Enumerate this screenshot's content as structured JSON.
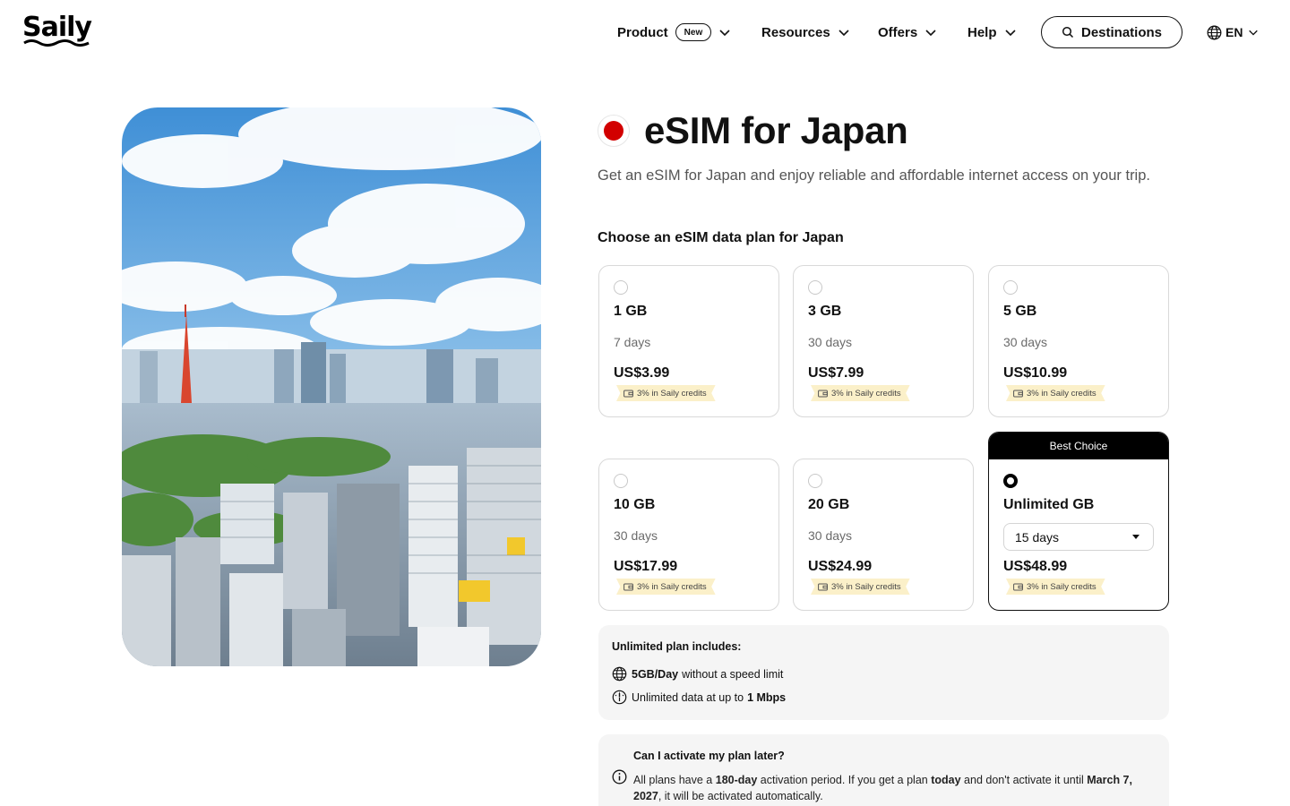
{
  "header": {
    "logo": "Saily",
    "nav": [
      {
        "label": "Product",
        "badge": "New"
      },
      {
        "label": "Resources"
      },
      {
        "label": "Offers"
      },
      {
        "label": "Help"
      }
    ],
    "destinations_label": "Destinations",
    "language": "EN"
  },
  "hero": {
    "title": "eSIM for Japan",
    "subtitle": "Get an eSIM for Japan and enjoy reliable and affordable internet access on your trip.",
    "flag_color": "#d20000"
  },
  "plans_heading": "Choose an eSIM data plan for Japan",
  "plans": [
    {
      "data": "1 GB",
      "duration": "7 days",
      "price": "US$3.99",
      "credit": "3% in Saily credits",
      "selected": false
    },
    {
      "data": "3 GB",
      "duration": "30 days",
      "price": "US$7.99",
      "credit": "3% in Saily credits",
      "selected": false
    },
    {
      "data": "5 GB",
      "duration": "30 days",
      "price": "US$10.99",
      "credit": "3% in Saily credits",
      "selected": false
    },
    {
      "data": "10 GB",
      "duration": "30 days",
      "price": "US$17.99",
      "credit": "3% in Saily credits",
      "selected": false
    },
    {
      "data": "20 GB",
      "duration": "30 days",
      "price": "US$24.99",
      "credit": "3% in Saily credits",
      "selected": false
    },
    {
      "data": "Unlimited GB",
      "duration": "15 days",
      "price": "US$48.99",
      "credit": "3% in Saily credits",
      "selected": true,
      "badge": "Best Choice"
    }
  ],
  "unlimited_info": {
    "heading": "Unlimited plan includes:",
    "row1_bold": "5GB/Day",
    "row1_text": "without a speed limit",
    "row2_text": "Unlimited data at up to",
    "row2_bold": "1 Mbps"
  },
  "faq": {
    "question": "Can I activate my plan later?",
    "a_part1": "All plans have a",
    "a_bold1": "180-day",
    "a_part2": "activation period. If you get a plan",
    "a_bold2": "today",
    "a_part3": "and don't activate it until",
    "a_bold3": "March 7, 2027",
    "a_part4": ", it will be activated automatically."
  },
  "colors": {
    "accent": "#000000",
    "credit_bg": "#fbf0c9",
    "panel_bg": "#f5f5f5"
  }
}
